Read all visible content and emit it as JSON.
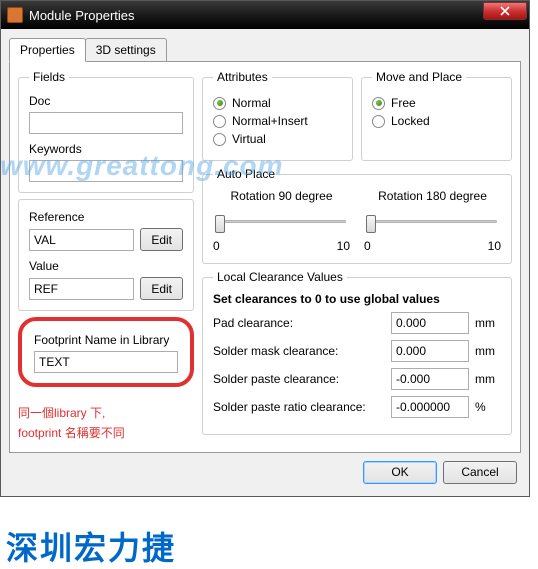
{
  "titlebar": {
    "title": "Module Properties"
  },
  "tabs": {
    "properties": "Properties",
    "settings3d": "3D settings"
  },
  "fields": {
    "legend": "Fields",
    "doc_label": "Doc",
    "doc_value": "",
    "keywords_label": "Keywords",
    "keywords_value": "",
    "reference_label": "Reference",
    "reference_value": "VAL",
    "value_label": "Value",
    "value_value": "REF",
    "edit_btn": "Edit"
  },
  "footprint": {
    "label": "Footprint Name in Library",
    "value": "TEXT"
  },
  "annotation": {
    "line1": "同一個library 下,",
    "line2": "footprint 名稱要不同"
  },
  "attributes": {
    "legend": "Attributes",
    "opts": [
      "Normal",
      "Normal+Insert",
      "Virtual"
    ],
    "selected": 0
  },
  "moveplace": {
    "legend": "Move and Place",
    "opts": [
      "Free",
      "Locked"
    ],
    "selected": 0
  },
  "autoplace": {
    "legend": "Auto Place",
    "rot90": "Rotation 90 degree",
    "rot180": "Rotation 180 degree",
    "min": "0",
    "max": "10"
  },
  "lcv": {
    "legend": "Local Clearance Values",
    "hint": "Set clearances to 0 to use global values",
    "rows": [
      {
        "label": "Pad clearance:",
        "value": "0.000",
        "unit": "mm"
      },
      {
        "label": "Solder mask clearance:",
        "value": "0.000",
        "unit": "mm"
      },
      {
        "label": "Solder paste clearance:",
        "value": "-0.000",
        "unit": "mm"
      },
      {
        "label": "Solder paste ratio clearance:",
        "value": "-0.000000",
        "unit": "%"
      }
    ]
  },
  "dialog": {
    "ok": "OK",
    "cancel": "Cancel"
  },
  "watermark": {
    "url": "www.greattong.com",
    "brand": "深圳宏力捷"
  }
}
